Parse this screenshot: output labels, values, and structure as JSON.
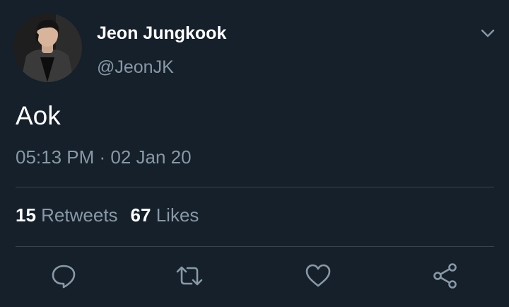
{
  "tweet": {
    "author": {
      "display_name": "Jeon Jungkook",
      "handle": "@JeonJK"
    },
    "text": "Aok",
    "timestamp": "05:13 PM · 02 Jan 20",
    "stats": {
      "retweets_count": "15",
      "retweets_label": "Retweets",
      "likes_count": "67",
      "likes_label": "Likes"
    }
  },
  "icons": {
    "menu": "chevron-down-icon",
    "reply": "reply-icon",
    "retweet": "retweet-icon",
    "like": "heart-icon",
    "share": "share-icon"
  },
  "colors": {
    "background": "#15202b",
    "primary_text": "#ffffff",
    "secondary_text": "#8899a6",
    "divider": "#38444d"
  }
}
